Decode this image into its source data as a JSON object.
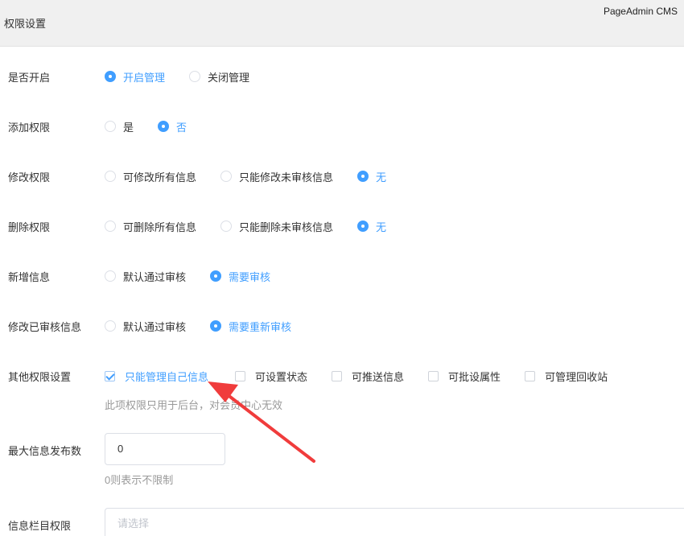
{
  "header": {
    "title": "权限设置",
    "brand": "PageAdmin CMS"
  },
  "rows": [
    {
      "label": "是否开启",
      "options": [
        {
          "text": "开启管理",
          "selected": true
        },
        {
          "text": "关闭管理",
          "selected": false
        }
      ]
    },
    {
      "label": "添加权限",
      "options": [
        {
          "text": "是",
          "selected": false
        },
        {
          "text": "否",
          "selected": true
        }
      ]
    },
    {
      "label": "修改权限",
      "options": [
        {
          "text": "可修改所有信息",
          "selected": false
        },
        {
          "text": "只能修改未审核信息",
          "selected": false
        },
        {
          "text": "无",
          "selected": true
        }
      ]
    },
    {
      "label": "删除权限",
      "options": [
        {
          "text": "可删除所有信息",
          "selected": false
        },
        {
          "text": "只能删除未审核信息",
          "selected": false
        },
        {
          "text": "无",
          "selected": true
        }
      ]
    },
    {
      "label": "新增信息",
      "options": [
        {
          "text": "默认通过审核",
          "selected": false
        },
        {
          "text": "需要审核",
          "selected": true
        }
      ]
    },
    {
      "label": "修改已审核信息",
      "options": [
        {
          "text": "默认通过审核",
          "selected": false
        },
        {
          "text": "需要重新审核",
          "selected": true
        }
      ]
    }
  ],
  "other": {
    "label": "其他权限设置",
    "checkboxes": [
      {
        "text": "只能管理自己信息",
        "checked": true
      },
      {
        "text": "可设置状态",
        "checked": false
      },
      {
        "text": "可推送信息",
        "checked": false
      },
      {
        "text": "可批设属性",
        "checked": false
      },
      {
        "text": "可管理回收站",
        "checked": false
      }
    ],
    "hint": "此项权限只用于后台，对会员中心无效"
  },
  "max_publish": {
    "label": "最大信息发布数",
    "value": "0",
    "hint": "0则表示不限制"
  },
  "column_permission": {
    "label": "信息栏目权限",
    "placeholder": "请选择"
  },
  "colors": {
    "accent": "#409eff",
    "annotation_arrow": "#f03c3c"
  }
}
